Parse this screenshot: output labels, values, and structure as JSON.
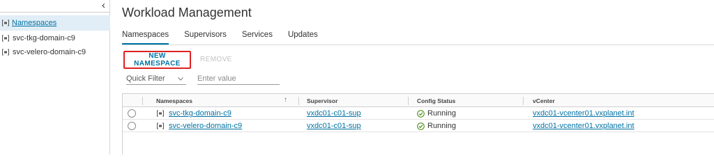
{
  "sidebar": {
    "collapse_glyph": "‹",
    "root_label": "Namespaces",
    "items": [
      {
        "label": "svc-tkg-domain-c9",
        "icon": "namespace-icon"
      },
      {
        "label": "svc-velero-domain-c9",
        "icon": "namespace-icon"
      }
    ]
  },
  "page": {
    "title": "Workload Management"
  },
  "tabs": [
    {
      "label": "Namespaces",
      "active": true
    },
    {
      "label": "Supervisors",
      "active": false
    },
    {
      "label": "Services",
      "active": false
    },
    {
      "label": "Updates",
      "active": false
    }
  ],
  "toolbar": {
    "new_namespace": "NEW NAMESPACE",
    "remove": "REMOVE"
  },
  "filter": {
    "quick_filter": "Quick Filter",
    "placeholder": "Enter value"
  },
  "grid": {
    "columns": [
      "Namespaces",
      "Supervisor",
      "Config Status",
      "vCenter"
    ],
    "sort_glyph": "↑",
    "rows": [
      {
        "namespace": "svc-tkg-domain-c9",
        "supervisor": "vxdc01-c01-sup",
        "status": "Running",
        "vcenter": "vxdc01-vcenter01.vxplanet.int"
      },
      {
        "namespace": "svc-velero-domain-c9",
        "supervisor": "vxdc01-c01-sup",
        "status": "Running",
        "vcenter": "vxdc01-vcenter01.vxplanet.int"
      }
    ]
  },
  "colors": {
    "link": "#0072a3",
    "highlight": "#e02020",
    "selected_bg": "#e1eef7"
  }
}
